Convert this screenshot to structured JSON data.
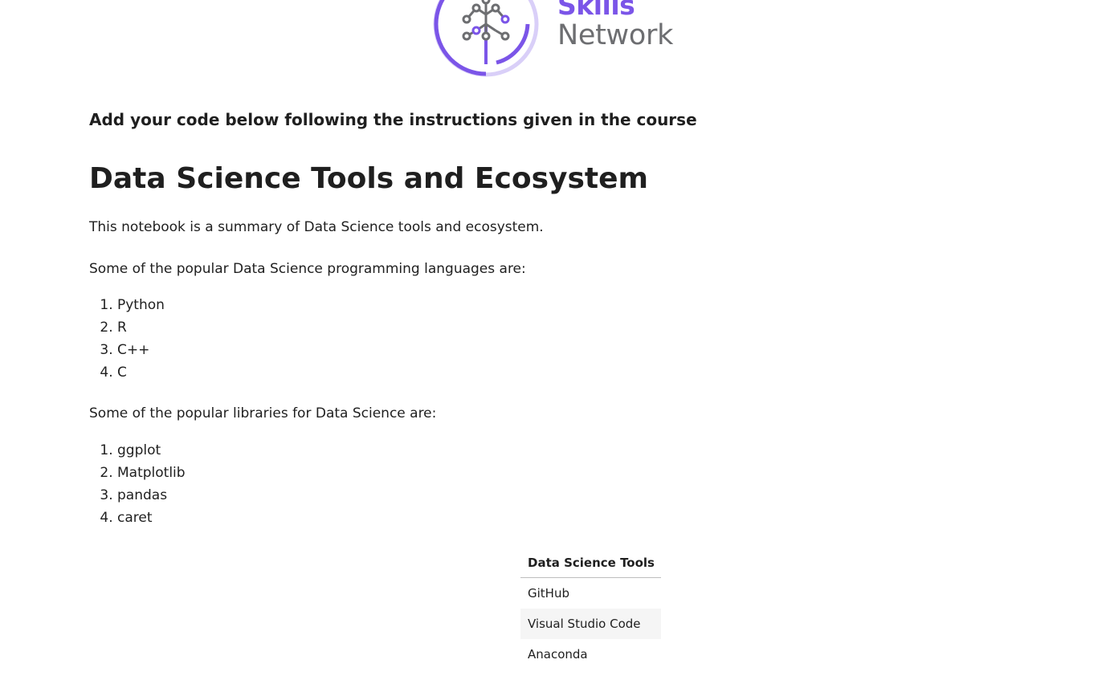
{
  "logo": {
    "line1": "Skills",
    "line2": "Network",
    "icon": "skills-network-tree-icon"
  },
  "instructions": "Add your code below following the instructions given in the course",
  "title": "Data Science Tools and Ecosystem",
  "intro": "This notebook is a summary of Data Science tools and ecosystem.",
  "languages": {
    "heading": "Some of the popular Data Science programming languages are:",
    "items": [
      "Python",
      "R",
      "C++",
      "C"
    ]
  },
  "libraries": {
    "heading": "Some of the popular libraries for Data Science are:",
    "items": [
      "ggplot",
      "Matplotlib",
      "pandas",
      "caret"
    ]
  },
  "tools_table": {
    "header": "Data Science Tools",
    "rows": [
      "GitHub",
      "Visual Studio Code",
      "Anaconda"
    ]
  },
  "colors": {
    "brand_purple": "#7b55e8",
    "brand_gray": "#6d6e71",
    "text": "#1f1f1f"
  }
}
